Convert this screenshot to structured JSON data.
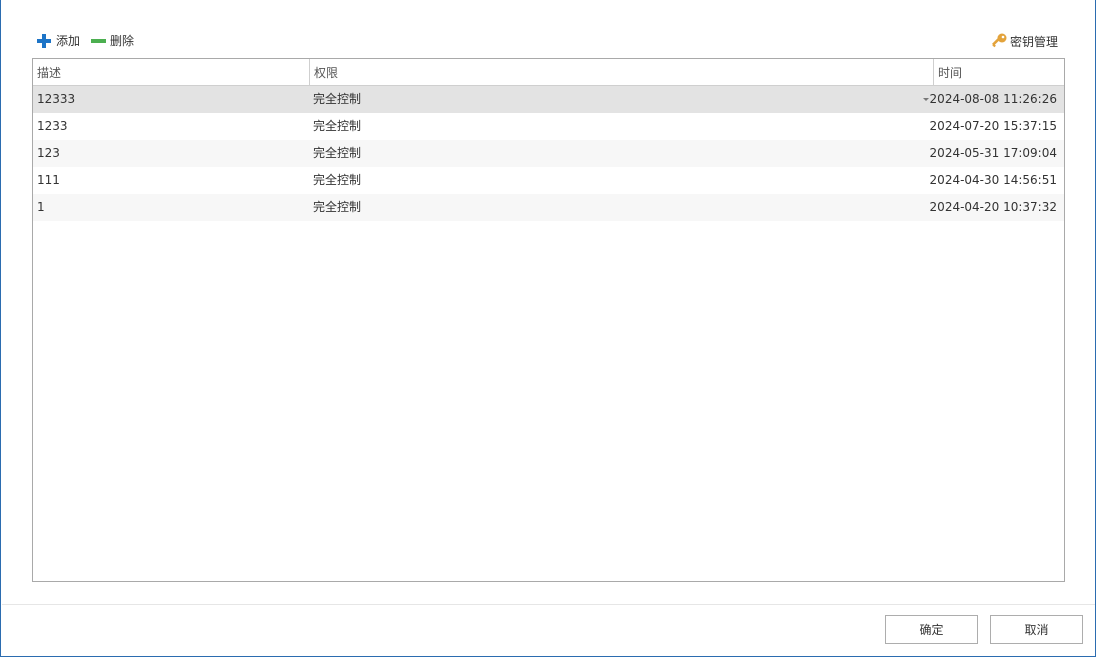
{
  "toolbar": {
    "add_label": "添加",
    "delete_label": "删除",
    "key_manage_label": "密钥管理"
  },
  "grid": {
    "columns": [
      "描述",
      "权限",
      "时间"
    ],
    "rows": [
      {
        "desc": "12333",
        "perm": "完全控制",
        "time": "2024-08-08 11:26:26",
        "selected": true
      },
      {
        "desc": "1233",
        "perm": "完全控制",
        "time": "2024-07-20 15:37:15"
      },
      {
        "desc": "123",
        "perm": "完全控制",
        "time": "2024-05-31 17:09:04"
      },
      {
        "desc": "111",
        "perm": "完全控制",
        "time": "2024-04-30 14:56:51"
      },
      {
        "desc": "1",
        "perm": "完全控制",
        "time": "2024-04-20 10:37:32"
      }
    ]
  },
  "footer": {
    "ok_label": "确定",
    "cancel_label": "取消"
  },
  "colors": {
    "add_icon": "#1d74c7",
    "delete_icon": "#4caf50",
    "key_icon": "#e3a33b",
    "window_border": "#2b6cb0",
    "selected_row": "#e3e3e3"
  }
}
